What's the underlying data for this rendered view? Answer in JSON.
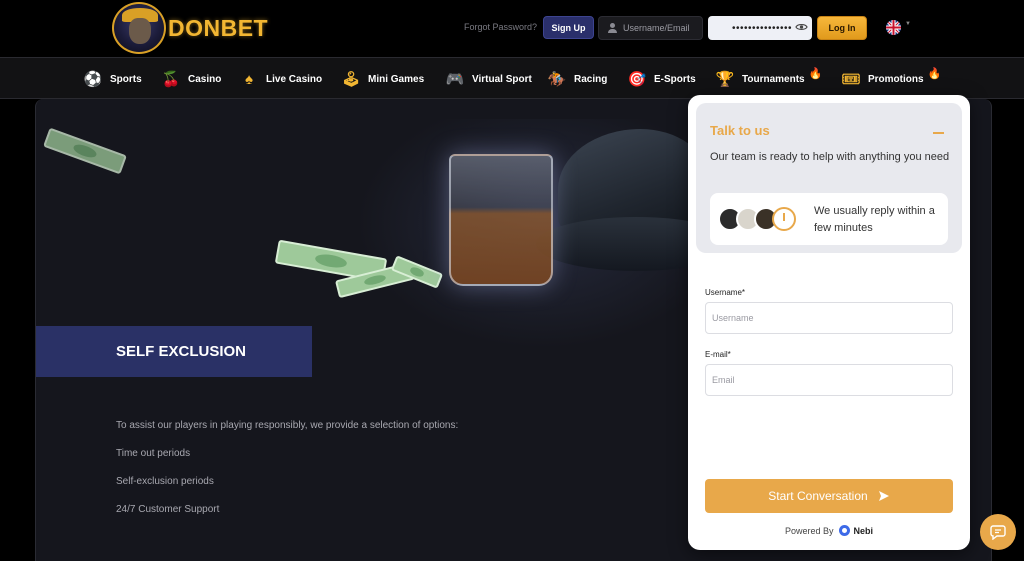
{
  "brand": {
    "name": "DONBET"
  },
  "auth": {
    "forgot_password": "Forgot Password?",
    "signup_label": "Sign Up",
    "username_placeholder": "Username/Email",
    "password_value": "•••••••••••••••",
    "login_label": "Log In",
    "language": "EN"
  },
  "nav": {
    "items": [
      {
        "label": "Sports",
        "icon": "sports-ball-icon"
      },
      {
        "label": "Casino",
        "icon": "casino-icon"
      },
      {
        "label": "Live Casino",
        "icon": "spade-icon"
      },
      {
        "label": "Mini Games",
        "icon": "mini-games-icon"
      },
      {
        "label": "Virtual Sport",
        "icon": "gamepad-icon"
      },
      {
        "label": "Racing",
        "icon": "horse-icon"
      },
      {
        "label": "E-Sports",
        "icon": "esports-icon"
      },
      {
        "label": "Tournaments",
        "icon": "trophy-icon",
        "hot": true
      },
      {
        "label": "Promotions",
        "icon": "ticket-icon",
        "hot": true
      }
    ]
  },
  "page": {
    "title": "SELF EXCLUSION",
    "intro": "To assist our players in playing responsibly, we provide a selection of options:",
    "options": [
      "Time out periods",
      "Self-exclusion periods",
      "24/7 Customer Support"
    ]
  },
  "chat": {
    "title": "Talk to us",
    "subtitle": "Our team is ready to help with anything you need",
    "reply_note": "We usually reply within a few minutes",
    "username_label": "Username*",
    "username_placeholder": "Username",
    "email_label": "E-mail*",
    "email_placeholder": "Email",
    "start_label": "Start Conversation",
    "powered_by": "Powered By",
    "provider": "Nebi"
  },
  "colors": {
    "accent": "#f2b632",
    "chat_accent": "#e8a84a",
    "signup_bg": "#2a2f6b",
    "title_box_bg": "#2a3166"
  }
}
